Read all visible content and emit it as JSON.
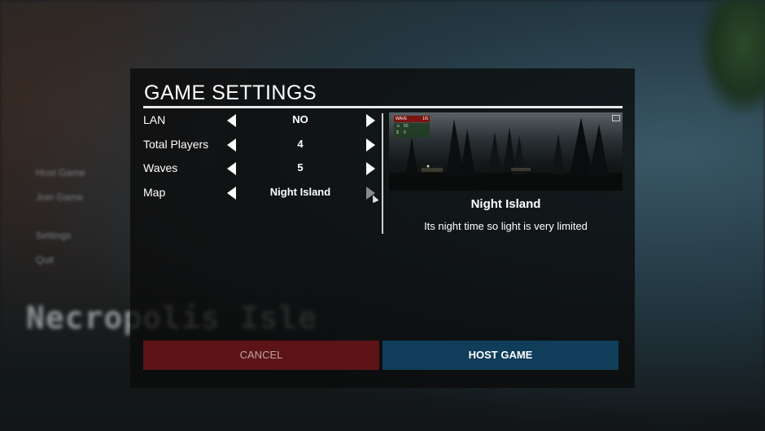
{
  "background": {
    "menu_items": [
      "Host Game",
      "Join Game",
      "Settings",
      "Quit"
    ],
    "logo": "Necropolis Isle"
  },
  "dialog": {
    "title": "GAME SETTINGS",
    "settings": [
      {
        "label": "LAN",
        "value": "NO"
      },
      {
        "label": "Total Players",
        "value": "4"
      },
      {
        "label": "Waves",
        "value": "5"
      },
      {
        "label": "Map",
        "value": "Night Island"
      }
    ],
    "preview": {
      "hud_wave_label": "WAVE",
      "hud_wave_count": "1/5",
      "hud_health": "50",
      "hud_money_symbol": "$",
      "hud_money": "0"
    },
    "map_name": "Night Island",
    "map_description": "Its night time so light is very limited",
    "cancel_label": "CANCEL",
    "host_label": "HOST GAME"
  },
  "colors": {
    "cancel_bg": "#5c1417",
    "host_bg": "#0f3d5a",
    "panel_bg": "#0a0a0a"
  },
  "icons": [
    "arrow-left-icon",
    "arrow-right-icon",
    "camera-icon",
    "cursor-icon"
  ]
}
